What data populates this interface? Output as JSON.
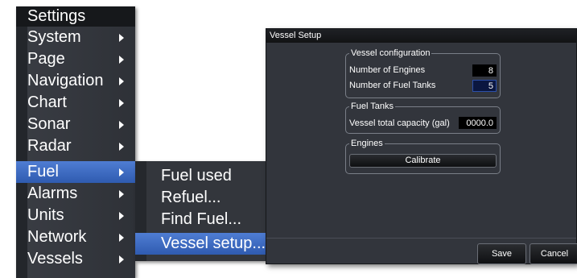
{
  "menu": {
    "title": "Settings",
    "items": [
      {
        "label": "System",
        "has_submenu": true
      },
      {
        "label": "Page",
        "has_submenu": true
      },
      {
        "label": "Navigation",
        "has_submenu": true
      },
      {
        "label": "Chart",
        "has_submenu": true
      },
      {
        "label": "Sonar",
        "has_submenu": true
      },
      {
        "label": "Radar",
        "has_submenu": true
      },
      {
        "label": "Fuel",
        "has_submenu": true,
        "selected": true
      },
      {
        "label": "Alarms",
        "has_submenu": true
      },
      {
        "label": "Units",
        "has_submenu": true
      },
      {
        "label": "Network",
        "has_submenu": true
      },
      {
        "label": "Vessels",
        "has_submenu": true
      }
    ]
  },
  "fuel_submenu": {
    "items": [
      {
        "label": "Fuel used"
      },
      {
        "label": "Refuel..."
      },
      {
        "label": "Find Fuel..."
      },
      {
        "label": "Vessel setup...",
        "selected": true
      }
    ]
  },
  "dialog": {
    "title": "Vessel Setup",
    "vessel_config": {
      "legend": "Vessel configuration",
      "engines_label": "Number of Engines",
      "engines_value": "8",
      "tanks_label": "Number of Fuel Tanks",
      "tanks_value": "5"
    },
    "fuel_tanks": {
      "legend": "Fuel Tanks",
      "capacity_label": "Vessel total capacity (gal)",
      "capacity_value": "0000.0"
    },
    "engines": {
      "legend": "Engines",
      "calibrate_label": "Calibrate"
    },
    "save_label": "Save",
    "cancel_label": "Cancel"
  },
  "colors": {
    "selected": "#3a68c4",
    "panel": "#32353c",
    "title_bar": "#16181b"
  }
}
